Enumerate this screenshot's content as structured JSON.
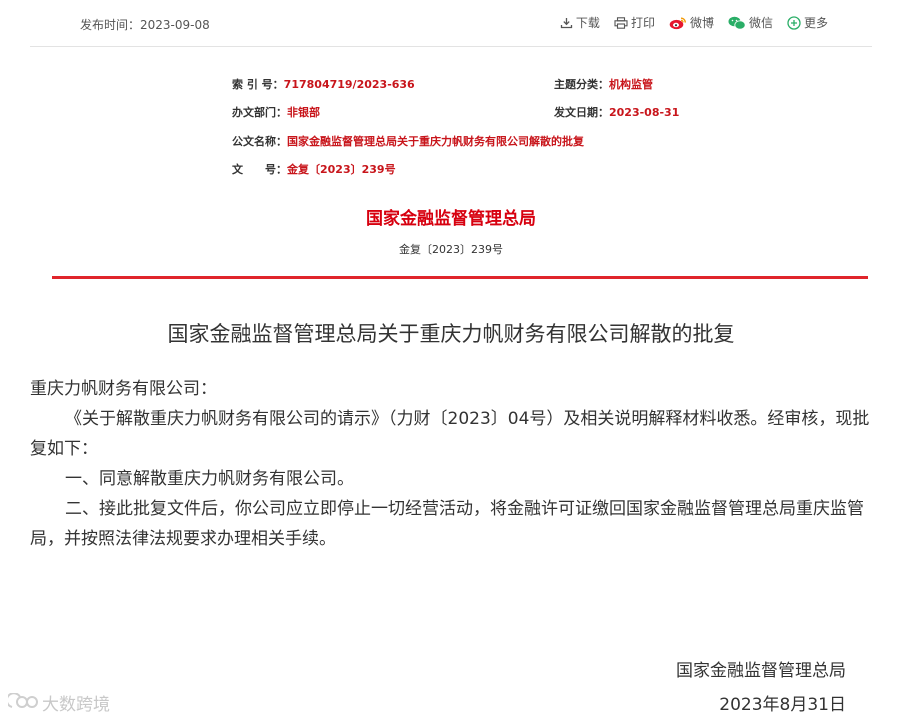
{
  "header": {
    "publish_label": "发布时间：",
    "publish_date": "2023-09-08",
    "tools": {
      "download": "下载",
      "print": "打印",
      "weibo": "微博",
      "wechat": "微信",
      "more": "更多"
    }
  },
  "meta": {
    "index_key": "索 引 号：",
    "index_val": "717804719/2023-636",
    "topic_key": "主题分类：",
    "topic_val": "机构监管",
    "dept_key": "办文部门：",
    "dept_val": "非银部",
    "date_key": "发文日期：",
    "date_val": "2023-08-31",
    "name_key": "公文名称：",
    "name_val": "国家金融监督管理总局关于重庆力帆财务有限公司解散的批复",
    "num_key": "文　　号：",
    "num_val": "金复〔2023〕239号"
  },
  "document": {
    "authority": "国家金融监督管理总局",
    "doc_number": "金复〔2023〕239号",
    "title": "国家金融监督管理总局关于重庆力帆财务有限公司解散的批复",
    "salutation": "重庆力帆财务有限公司：",
    "paragraphs": [
      "《关于解散重庆力帆财务有限公司的请示》（力财〔2023〕04号）及相关说明解释材料收悉。经审核，现批复如下：",
      "一、同意解散重庆力帆财务有限公司。",
      "二、接此批复文件后，你公司应立即停止一切经营活动，将金融许可证缴回国家金融监督管理总局重庆监管局，并按照法律法规要求办理相关手续。"
    ],
    "signature_org": "国家金融监督管理总局",
    "signature_date": "2023年8月31日"
  },
  "watermark": {
    "text": "大数跨境"
  }
}
